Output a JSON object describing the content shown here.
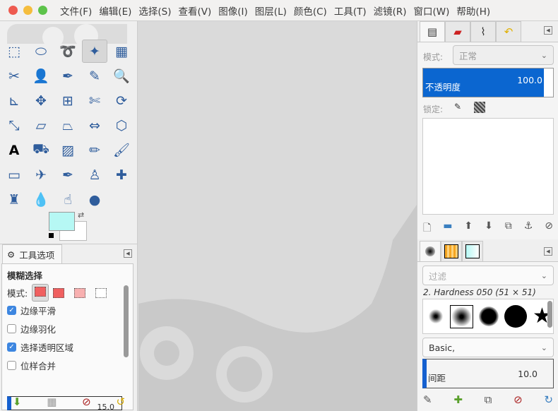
{
  "menubar": {
    "items": [
      "文件(F)",
      "编辑(E)",
      "选择(S)",
      "查看(V)",
      "图像(I)",
      "图层(L)",
      "颜色(C)",
      "工具(T)",
      "滤镜(R)",
      "窗口(W)",
      "帮助(H)"
    ],
    "traffic_lights": [
      "#ee5a4f",
      "#f5bd3d",
      "#5dc34a"
    ]
  },
  "toolbox": {
    "tools": [
      "rect-select",
      "ellipse-select",
      "free-select",
      "fuzzy-select",
      "select-by-color",
      "scissors",
      "foreground-select",
      "paths",
      "color-picker",
      "zoom",
      "measure",
      "move",
      "align",
      "crop",
      "rotate",
      "scale",
      "shear",
      "perspective",
      "flip",
      "cage-transform",
      "text",
      "bucket-fill",
      "blend",
      "pencil",
      "paintbrush",
      "eraser",
      "airbrush",
      "ink",
      "clone",
      "heal",
      "perspective-clone",
      "blur",
      "smudge",
      "dodge-burn"
    ],
    "active_index": 3,
    "fg_color": "#b6f8f4",
    "bg_color": "#ffffff"
  },
  "tool_options": {
    "tab_label": "工具选项",
    "title": "模糊选择",
    "mode_label": "模式:",
    "options": [
      {
        "label": "边缘平滑",
        "checked": true
      },
      {
        "label": "边缘羽化",
        "checked": false
      },
      {
        "label": "选择透明区域",
        "checked": true
      },
      {
        "label": "位样合并",
        "checked": false
      }
    ],
    "threshold_partial": "15.0"
  },
  "layers": {
    "mode_label": "模式:",
    "mode_value": "正常",
    "opacity_label": "不透明度",
    "opacity_value": "100.0",
    "lock_label": "锁定:"
  },
  "brushes": {
    "filter_placeholder": "过滤",
    "brush_name": "2. Hardness 050 (51 × 51)",
    "tag_value": "Basic,",
    "spacing_label": "间距",
    "spacing_value": "10.0"
  }
}
